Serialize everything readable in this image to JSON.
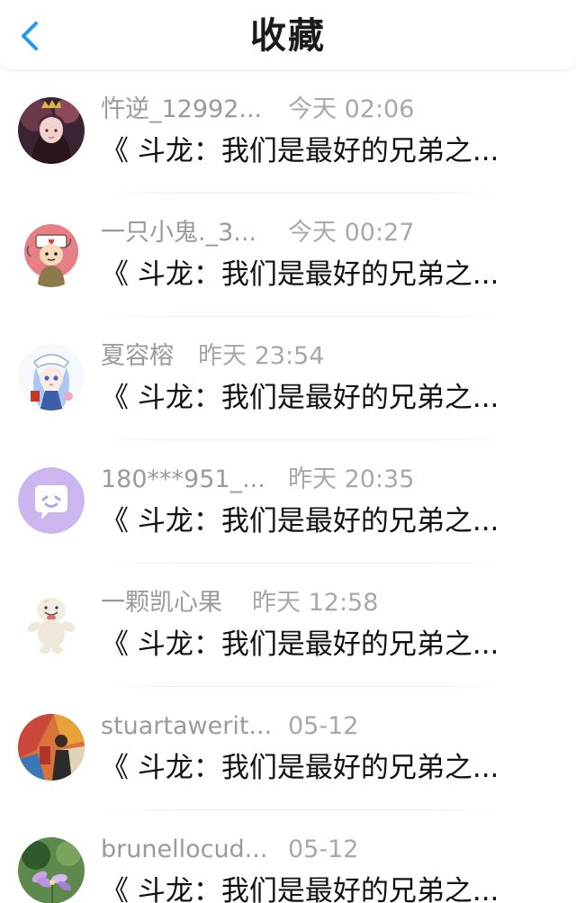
{
  "header": {
    "title": "收藏"
  },
  "items": [
    {
      "name": "忤逆_12992...",
      "time": "今天 02:06",
      "title": "《 斗龙：我们是最好的兄弟之..."
    },
    {
      "name": "一只小鬼._3...",
      "time": "今天 00:27",
      "title": "《 斗龙：我们是最好的兄弟之..."
    },
    {
      "name": "夏容榕",
      "time": "昨天 23:54",
      "title": "《 斗龙：我们是最好的兄弟之..."
    },
    {
      "name": "180***951_...",
      "time": "昨天 20:35",
      "title": "《 斗龙：我们是最好的兄弟之..."
    },
    {
      "name": "一颗凯心果",
      "time": "昨天 12:58",
      "title": "《 斗龙：我们是最好的兄弟之..."
    },
    {
      "name": "stuartawerit...",
      "time": "05-12",
      "title": "《 斗龙：我们是最好的兄弟之..."
    },
    {
      "name": "brunellocud...",
      "time": "05-12",
      "title": "《 斗龙：我们是最好的兄弟之..."
    }
  ],
  "colors": {
    "accent": "#1e9bf0",
    "title_text": "#1a1a1a",
    "meta_text": "#9a9a9a",
    "item_text": "#111111"
  },
  "icons": {
    "back": "chevron-left-icon"
  }
}
